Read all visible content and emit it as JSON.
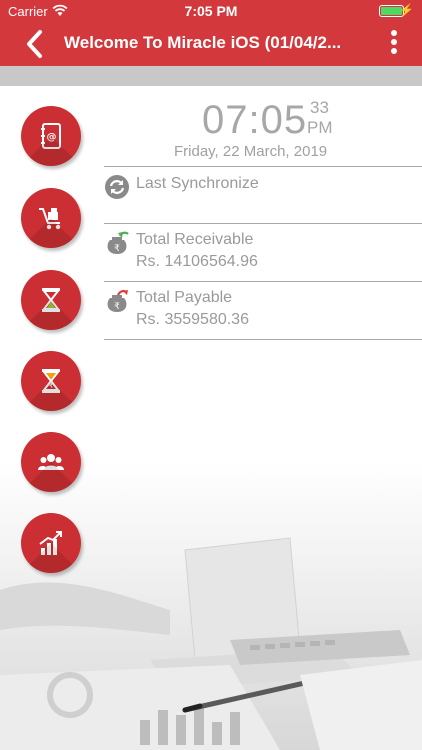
{
  "status_bar": {
    "carrier": "Carrier",
    "time": "7:05 PM",
    "battery_color": "#4cd964"
  },
  "nav": {
    "title": "Welcome To Miracle iOS (01/04/2...",
    "back_icon": "chevron-left-icon",
    "menu_icon": "more-vertical-icon",
    "bar_color": "#d3383c"
  },
  "clock": {
    "time": "07:05",
    "seconds": "33",
    "ampm": "PM",
    "date": "Friday, 22 March, 2019"
  },
  "info": {
    "sync": {
      "label": "Last Synchronize",
      "icon": "sync-icon"
    },
    "receivable": {
      "label": "Total Receivable",
      "value": "Rs. 14106564.96",
      "icon": "money-bag-in-icon"
    },
    "payable": {
      "label": "Total Payable",
      "value": "Rs. 3559580.36",
      "icon": "money-bag-out-icon"
    }
  },
  "side_menu": [
    {
      "icon": "address-book-icon"
    },
    {
      "icon": "cart-icon"
    },
    {
      "icon": "hourglass-icon"
    },
    {
      "icon": "hourglass-pending-icon"
    },
    {
      "icon": "users-icon"
    },
    {
      "icon": "growth-chart-icon"
    }
  ],
  "colors": {
    "accent": "#cc2f33",
    "divider": "#aaaaaa",
    "text_gray": "#9a9a9a"
  }
}
